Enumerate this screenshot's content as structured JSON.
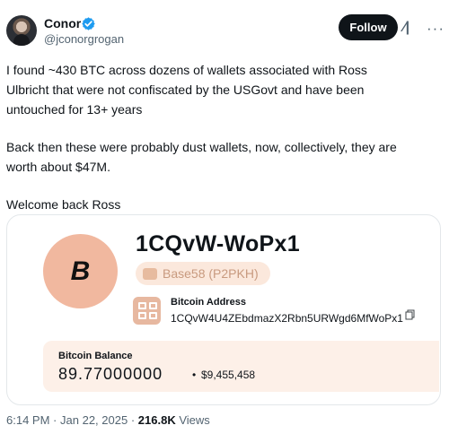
{
  "user": {
    "name": "Conor",
    "handle": "@jconorgrogan",
    "verified": true
  },
  "actions": {
    "follow_label": "Follow",
    "grok_icon": "grok-icon",
    "more_icon": "more-icon"
  },
  "tweet": {
    "line1": "I found ~430 BTC across dozens of wallets associated with Ross",
    "line2": "Ulbricht that were not confiscated by the USGovt and have been",
    "line3": "untouched for 13+ years",
    "line4": "Back then these were probably dust wallets, now, collectively, they are",
    "line5": "worth about $47M.",
    "line6": "Welcome back Ross"
  },
  "card": {
    "coin_symbol": "B",
    "short_address": "1CQvW-WoPx1",
    "encoding_badge": "Base58 (P2PKH)",
    "address_label": "Bitcoin Address",
    "full_address": "1CQvW4U4ZEbdmazX2Rbn5URWgd6MfWoPx1",
    "balance_label": "Bitcoin Balance",
    "balance_btc": "89.77000000",
    "balance_separator": "•",
    "balance_usd": "$9,455,458"
  },
  "meta": {
    "time": "6:14 PM",
    "separator": "·",
    "date": "Jan 22, 2025",
    "views_count": "216.8K",
    "views_label": "Views"
  },
  "colors": {
    "accent": "#1d9bf0",
    "follow_background": "#0f1419",
    "coin_background": "#f1b89f",
    "balance_background": "#fdf0e8"
  }
}
